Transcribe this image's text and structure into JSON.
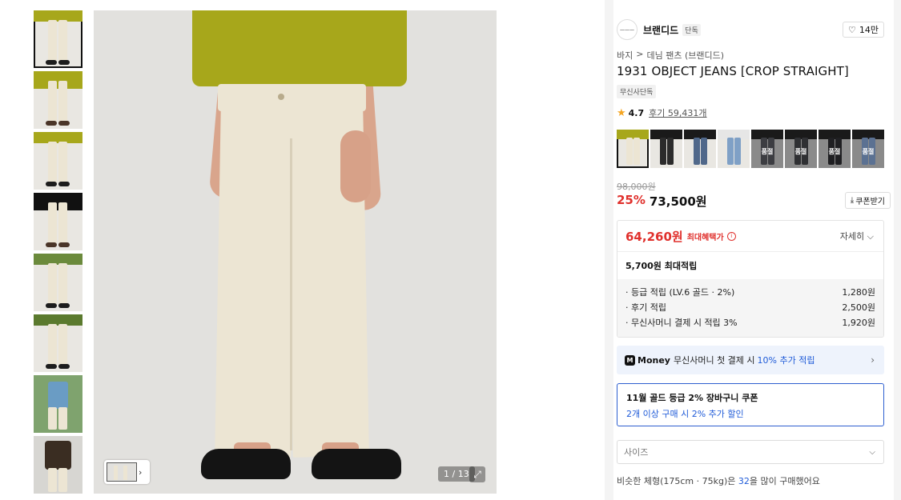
{
  "gallery": {
    "counter": "1 / 13",
    "expand_icon": "expand-icon",
    "mini_arrow": "›"
  },
  "brand": {
    "logo_text": "———",
    "name": "브랜디드",
    "badge": "단독",
    "likes": "14만"
  },
  "breadcrumb": {
    "level1": "바지",
    "separator": ">",
    "level2": "데님 팬츠 (브랜디드)"
  },
  "product": {
    "title": "1931 OBJECT JEANS [CROP STRAIGHT]",
    "exclusive_badge": "무신사단독",
    "rating": "4.7",
    "reviews": "후기 59,431개",
    "star": "★"
  },
  "colors": {
    "swatches": [
      {
        "label": "",
        "leg": "#ece5d3",
        "top": "#a7a71b",
        "bg": "#e9e7e2"
      },
      {
        "label": "",
        "leg": "#2b2b2b",
        "top": "#1a1a1a",
        "bg": "#e9e7e2"
      },
      {
        "label": "",
        "leg": "#50688a",
        "top": "#1a1a1a",
        "bg": "#e9e7e2"
      },
      {
        "label": "",
        "leg": "#7fa0c6",
        "top": "#e6e6e6",
        "bg": "#e9e7e2"
      },
      {
        "label": "품절",
        "leg": "#3c3d42",
        "top": "#1a1a1a",
        "bg": "#8a8a8a"
      },
      {
        "label": "품절",
        "leg": "#2f3033",
        "top": "#1a1a1a",
        "bg": "#8a8a8a"
      },
      {
        "label": "품절",
        "leg": "#1f1f22",
        "top": "#1a1a1a",
        "bg": "#8a8a8a"
      },
      {
        "label": "품절",
        "leg": "#5b7192",
        "top": "#1a1a1a",
        "bg": "#8a8a8a"
      }
    ]
  },
  "price": {
    "original": "98,000원",
    "discount": "25%",
    "sale": "73,500원",
    "coupon_button": "쿠폰받기",
    "coupon_icon": "⤓"
  },
  "benefit": {
    "max_price": "64,260원",
    "max_label": "최대혜택가",
    "info_icon": "i",
    "detail": "자세히 ⌵",
    "max_points": "5,700원 최대적립",
    "items": [
      {
        "label": "· 등급 적립 (LV.6 골드 · 2%)",
        "value": "1,280원"
      },
      {
        "label": "· 후기 적립",
        "value": "2,500원"
      },
      {
        "label": "· 무신사머니 결제 시 적립 3%",
        "value": "1,920원"
      }
    ]
  },
  "money": {
    "logo": "M",
    "brand": "Money",
    "text": "무신사머니 첫 결제 시",
    "highlight": "10% 추가 적립",
    "arrow": "›"
  },
  "coupon": {
    "title": "11월 골드 등급 2% 장바구니 쿠폰",
    "desc": "2개 이상 구매 시 2% 추가 할인"
  },
  "size": {
    "placeholder": "사이즈",
    "chevron": "⌵"
  },
  "similar": {
    "prefix": "비슷한 체형(175cm · 75kg)은",
    "count": "32",
    "suffix": "을 많이 구매했어요"
  },
  "icons": {
    "heart": "♡"
  }
}
